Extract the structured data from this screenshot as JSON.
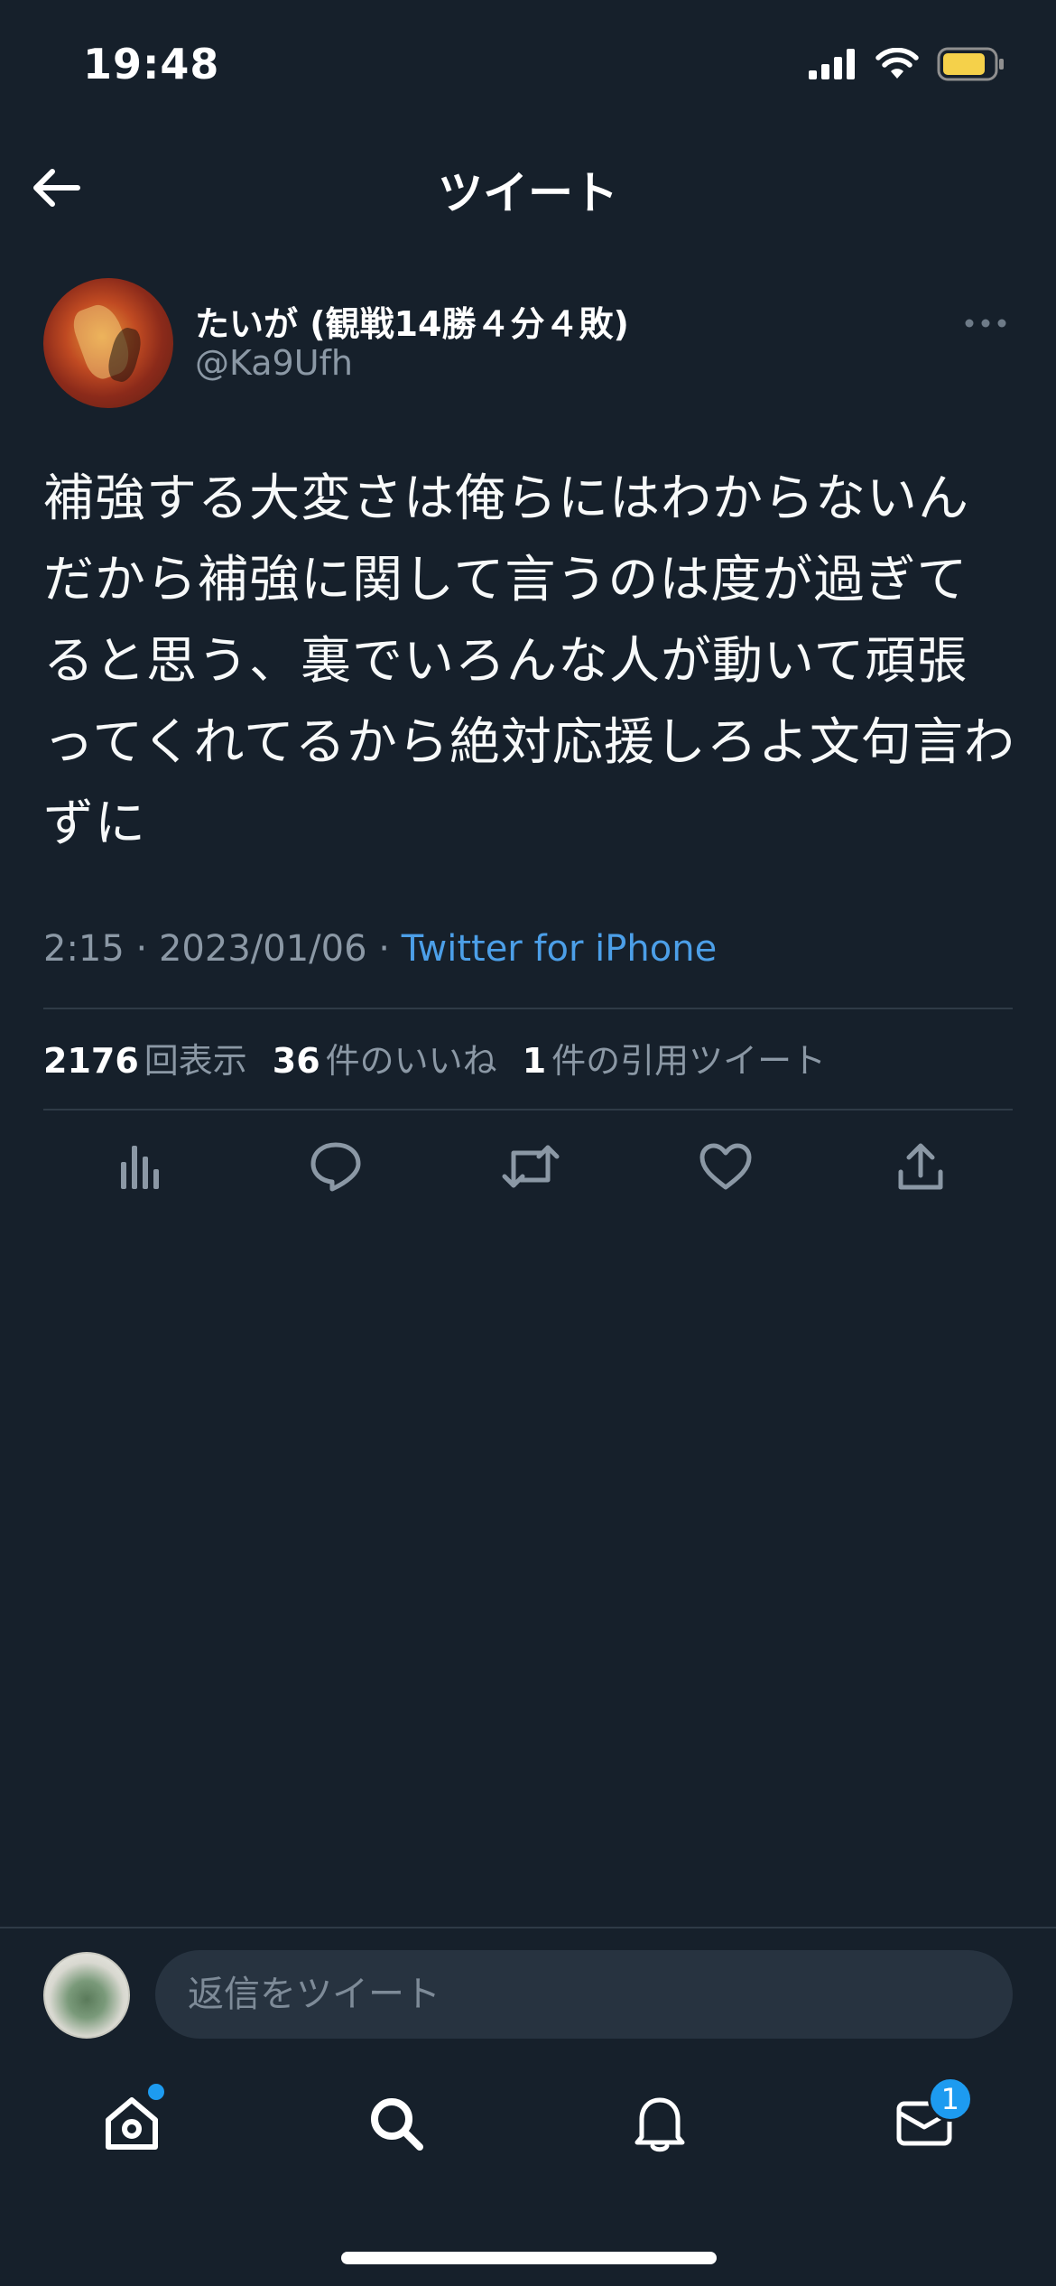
{
  "status_bar": {
    "time": "19:48"
  },
  "header": {
    "title": "ツイート"
  },
  "tweet": {
    "display_name": "たいが (観戦14勝４分４敗)",
    "handle": "@Ka9Ufh",
    "text": "補強する大変さは俺らにはわからないんだから補強に関して言うのは度が過ぎてると思う、裏でいろんな人が動いて頑張ってくれてるから絶対応援しろよ文句言わずに",
    "time": "2:15",
    "separator": "·",
    "date": "2023/01/06",
    "source": "Twitter for iPhone"
  },
  "stats": {
    "views_count": "2176",
    "views_label": "回表示",
    "likes_count": "36",
    "likes_label": "件のいいね",
    "quotes_count": "1",
    "quotes_label": "件の引用ツイート"
  },
  "actions": [
    "analytics-icon",
    "reply-icon",
    "retweet-icon",
    "like-icon",
    "share-icon"
  ],
  "reply": {
    "placeholder": "返信をツイート"
  },
  "tab_bar": {
    "tabs": [
      "home-icon",
      "search-icon",
      "notifications-icon",
      "messages-icon"
    ],
    "messages_badge": "1"
  },
  "colors": {
    "background": "#16202b",
    "accent": "#1d9bf0",
    "link": "#4c9fe8",
    "secondary_text": "#8b98a5",
    "battery": "#f5d14a"
  }
}
